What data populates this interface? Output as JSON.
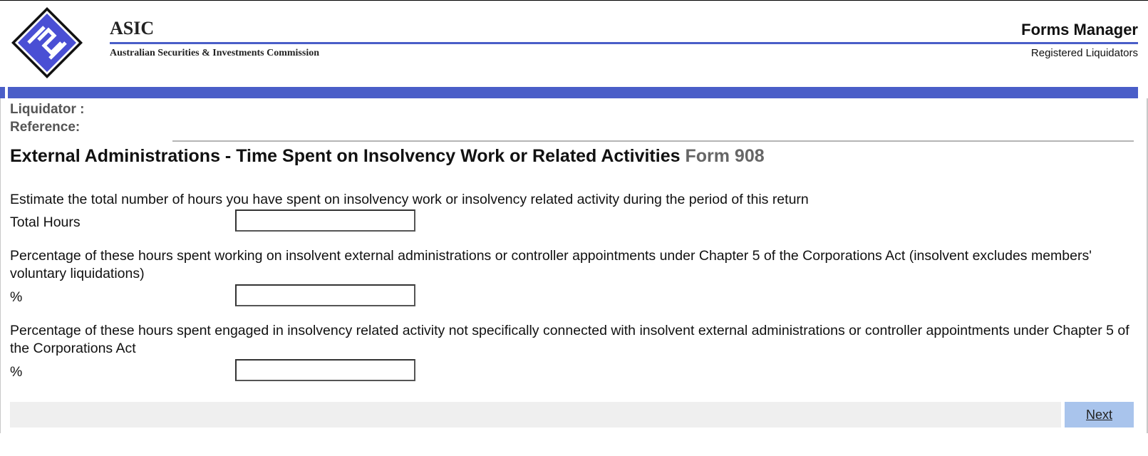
{
  "header": {
    "org_short": "ASIC",
    "org_full": "Australian Securities & Investments Commission",
    "app_name": "Forms Manager",
    "section": "Registered Liquidators",
    "brand_color": "#4a5ec8",
    "logo_icon": "asic-diamond-logo-icon"
  },
  "info": {
    "liquidator_label": "Liquidator :",
    "reference_label": "Reference:"
  },
  "form": {
    "title": "External Administrations - Time Spent on Insolvency Work or Related Activities",
    "form_number": "Form 908",
    "questions": [
      {
        "text": "Estimate the total number of hours you have spent on insolvency work or insolvency related activity during the period of this return",
        "field_label": "Total Hours",
        "value": ""
      },
      {
        "text": "Percentage of these hours spent working on insolvent external administrations or controller appointments under Chapter 5 of the Corporations Act (insolvent excludes members' voluntary liquidations)",
        "field_label": "%",
        "value": ""
      },
      {
        "text": "Percentage of these hours spent engaged in insolvency related activity not specifically connected with insolvent external administrations or controller appointments under Chapter 5 of the Corporations Act",
        "field_label": "%",
        "value": ""
      }
    ]
  },
  "footer": {
    "next_label": "Next",
    "next_color": "#a9c4ec"
  }
}
